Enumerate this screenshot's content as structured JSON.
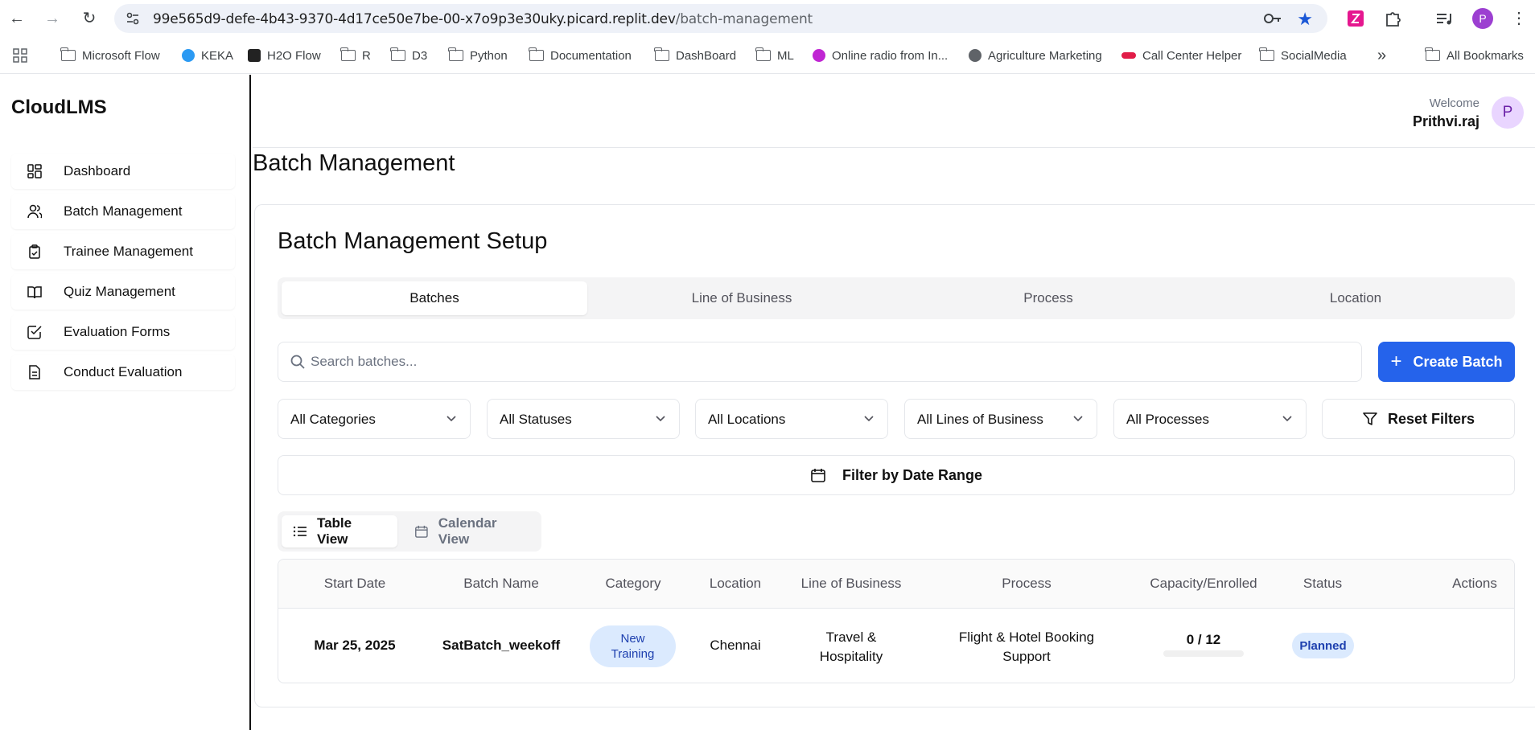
{
  "browser": {
    "url_host": "99e565d9-defe-4b43-9370-4d17ce50e7be-00-x7o9p3e30uky.picard.replit.dev",
    "url_path": "/batch-management",
    "profile_initial": "P",
    "bookmarks": [
      {
        "label": "Microsoft Flow",
        "icon": "folder-icon"
      },
      {
        "label": "KEKA",
        "icon": "keka-icon"
      },
      {
        "label": "H2O Flow",
        "icon": "h2o-icon"
      },
      {
        "label": "R",
        "icon": "folder-icon"
      },
      {
        "label": "D3",
        "icon": "folder-icon"
      },
      {
        "label": "Python",
        "icon": "folder-icon"
      },
      {
        "label": "Documentation",
        "icon": "folder-icon"
      },
      {
        "label": "DashBoard",
        "icon": "folder-icon"
      },
      {
        "label": "ML",
        "icon": "folder-icon"
      },
      {
        "label": "Online radio from In...",
        "icon": "radio-icon"
      },
      {
        "label": "Agriculture Marketing",
        "icon": "globe-icon"
      },
      {
        "label": "Call Center Helper",
        "icon": "dots-icon"
      },
      {
        "label": "SocialMedia",
        "icon": "folder-icon"
      }
    ],
    "all_bookmarks": "All Bookmarks",
    "more": "»"
  },
  "sidebar": {
    "brand": "CloudLMS",
    "items": [
      {
        "label": "Dashboard",
        "icon": "dashboard-icon"
      },
      {
        "label": "Batch Management",
        "icon": "users-icon"
      },
      {
        "label": "Trainee Management",
        "icon": "clipboard-icon"
      },
      {
        "label": "Quiz Management",
        "icon": "book-icon"
      },
      {
        "label": "Evaluation Forms",
        "icon": "checkbox-icon"
      },
      {
        "label": "Conduct Evaluation",
        "icon": "document-icon"
      }
    ]
  },
  "header": {
    "welcome": "Welcome",
    "user_name": "Prithvi.raj",
    "user_initial": "P"
  },
  "page": {
    "title": "Batch Management",
    "card_title": "Batch Management Setup",
    "tabs": [
      "Batches",
      "Line of Business",
      "Process",
      "Location"
    ],
    "active_tab": "Batches",
    "search_placeholder": "Search batches...",
    "create_label": "Create Batch",
    "filters": [
      "All Categories",
      "All Statuses",
      "All Locations",
      "All Lines of Business",
      "All Processes"
    ],
    "reset_label": "Reset Filters",
    "date_range_label": "Filter by Date Range",
    "views": {
      "table": "Table View",
      "calendar": "Calendar View"
    },
    "table": {
      "columns": [
        "Start Date",
        "Batch Name",
        "Category",
        "Location",
        "Line of Business",
        "Process",
        "Capacity/Enrolled",
        "Status",
        "Actions"
      ],
      "rows": [
        {
          "start_date": "Mar 25, 2025",
          "batch_name": "SatBatch_weekoff",
          "category_line1": "New",
          "category_line2": "Training",
          "location": "Chennai",
          "lob_line1": "Travel &",
          "lob_line2": "Hospitality",
          "process_line1": "Flight & Hotel Booking",
          "process_line2": "Support",
          "capacity": "0 / 12",
          "enrolled_fraction": 0,
          "status": "Planned"
        }
      ]
    }
  },
  "colors": {
    "primary": "#2563eb",
    "badge_bg": "#dbeafe",
    "badge_text": "#1e40af"
  }
}
